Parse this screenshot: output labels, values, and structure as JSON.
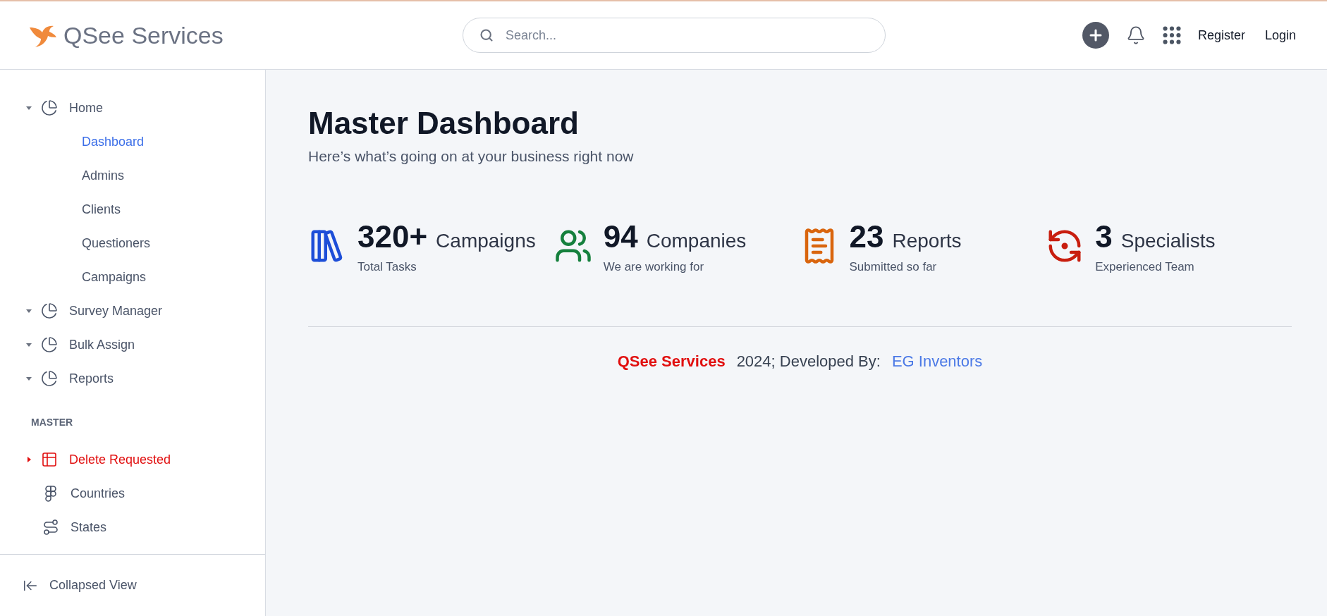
{
  "header": {
    "brand": "QSee Services",
    "search": {
      "placeholder": "Search..."
    },
    "links": [
      "Register",
      "Login"
    ]
  },
  "sidebar": {
    "sections": [
      {
        "items": [
          {
            "label": "Home",
            "expanded": true,
            "selected": false,
            "children": [
              {
                "label": "Dashboard",
                "selected": true
              },
              {
                "label": "Admins",
                "selected": false
              },
              {
                "label": "Clients",
                "selected": false
              },
              {
                "label": "Questioners",
                "selected": false
              },
              {
                "label": "Campaigns",
                "selected": false
              }
            ]
          },
          {
            "label": "Survey Manager",
            "expanded": true,
            "selected": false
          },
          {
            "label": "Bulk Assign",
            "expanded": true,
            "selected": false
          },
          {
            "label": "Reports",
            "expanded": true,
            "selected": false
          }
        ]
      },
      {
        "title": "MASTER",
        "items": [
          {
            "label": "Delete Requested",
            "expanded": false,
            "selected": true
          },
          {
            "label": "Countries",
            "selected": false
          },
          {
            "label": "States",
            "selected": false
          }
        ]
      }
    ],
    "footer_button": "Collapsed View"
  },
  "page": {
    "title": "Master Dashboard",
    "subtitle": "Here’s what’s going on at your business right now"
  },
  "stats": [
    {
      "value": "320+",
      "label": "Campaigns",
      "caption": "Total Tasks",
      "color": "#1d4ed8"
    },
    {
      "value": "94",
      "label": "Companies",
      "caption": "We are working for",
      "color": "#15803d"
    },
    {
      "value": "23",
      "label": "Reports",
      "caption": "Submitted so far",
      "color": "#d9650e"
    },
    {
      "value": "3",
      "label": "Specialists",
      "caption": "Experienced Team",
      "color": "#c81e0f"
    }
  ],
  "footer": {
    "brand": "QSee Services",
    "text": "2024; Developed By:",
    "link": "EG Inventors"
  }
}
